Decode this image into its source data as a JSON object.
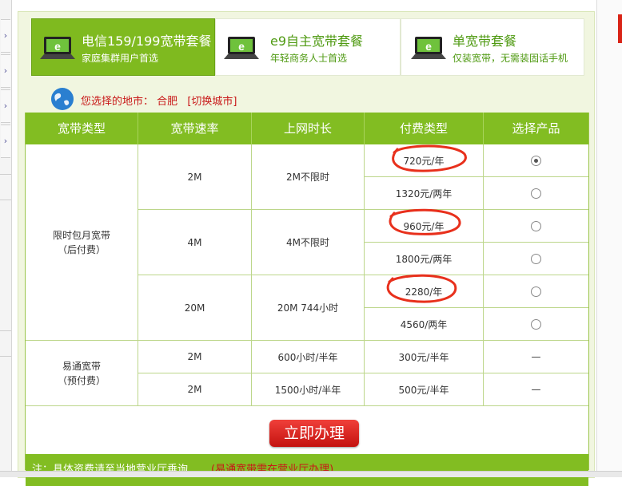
{
  "tabs": [
    {
      "title": "电信159/199宽带套餐",
      "subtitle": "家庭集群用户首选",
      "active": true
    },
    {
      "title": "e9自主宽带套餐",
      "subtitle": "年轻商务人士首选",
      "active": false
    },
    {
      "title": "单宽带套餐",
      "subtitle": "仅装宽带，无需装固话手机",
      "active": false
    }
  ],
  "city": {
    "label": "您选择的地市：",
    "name": "合肥",
    "switch": "[切换城市]"
  },
  "table": {
    "headers": [
      "宽带类型",
      "宽带速率",
      "上网时长",
      "付费类型",
      "选择产品"
    ],
    "groups": [
      {
        "type_line1": "限时包月宽带",
        "type_line2": "（后付费）"
      },
      {
        "type_line1": "易通宽带",
        "type_line2": "（预付费）"
      }
    ],
    "speeds": [
      {
        "rate": "2M",
        "duration": "2M不限时"
      },
      {
        "rate": "4M",
        "duration": "4M不限时"
      },
      {
        "rate": "20M",
        "duration": "20M 744小时"
      },
      {
        "rate": "2M",
        "duration": "600小时/半年"
      },
      {
        "rate": "2M",
        "duration": "1500小时/半年"
      }
    ],
    "prices": [
      "720元/年",
      "1320元/两年",
      "960元/年",
      "1800元/两年",
      "2280/年",
      "4560/两年",
      "300元/半年",
      "500元/半年"
    ],
    "selection": [
      "checked",
      "radio",
      "radio",
      "radio",
      "radio",
      "radio",
      "—",
      "—"
    ]
  },
  "apply_button": "立即办理",
  "note": {
    "main": "注：具体资费请至当地营业厅垂询",
    "highlight": "(易通宽带需在营业厅办理)"
  },
  "colors": {
    "accent": "#82bd22",
    "annotation": "#e8301c",
    "text_red": "#c81717"
  }
}
